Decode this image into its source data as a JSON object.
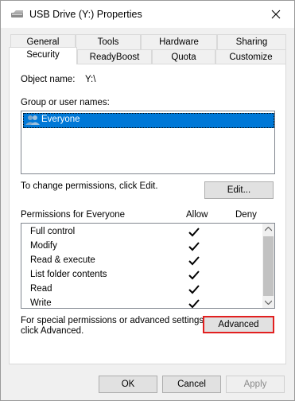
{
  "window": {
    "title": "USB Drive (Y:) Properties"
  },
  "tabs_row1": [
    "General",
    "Tools",
    "Hardware",
    "Sharing"
  ],
  "tabs_row2": [
    "Security",
    "ReadyBoost",
    "Quota",
    "Customize"
  ],
  "security": {
    "object_label": "Object name:",
    "object_value": "Y:\\",
    "group_label": "Group or user names:",
    "users": [
      "Everyone"
    ],
    "change_hint": "To change permissions, click Edit.",
    "edit_button": "Edit...",
    "permissions_for": "Permissions for Everyone",
    "allow_header": "Allow",
    "deny_header": "Deny",
    "permissions": [
      {
        "name": "Full control",
        "allow": true,
        "deny": false
      },
      {
        "name": "Modify",
        "allow": true,
        "deny": false
      },
      {
        "name": "Read & execute",
        "allow": true,
        "deny": false
      },
      {
        "name": "List folder contents",
        "allow": true,
        "deny": false
      },
      {
        "name": "Read",
        "allow": true,
        "deny": false
      },
      {
        "name": "Write",
        "allow": true,
        "deny": false
      }
    ],
    "special_hint_1": "For special permissions or advanced settings,",
    "special_hint_2": "click Advanced.",
    "advanced_button": "Advanced"
  },
  "footer": {
    "ok": "OK",
    "cancel": "Cancel",
    "apply": "Apply"
  },
  "colors": {
    "selection": "#0078d7",
    "highlight_border": "#e22020"
  }
}
